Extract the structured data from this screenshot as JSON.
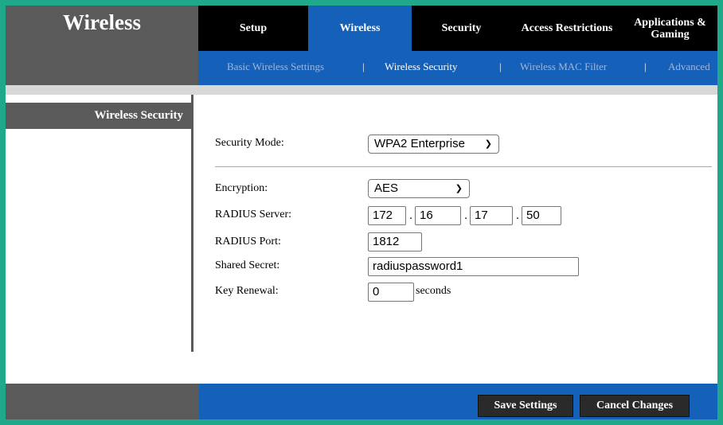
{
  "brand": {
    "title": "Wireless"
  },
  "tabs": [
    {
      "label": "Setup",
      "active": false
    },
    {
      "label": "Wireless",
      "active": true
    },
    {
      "label": "Security",
      "active": false
    },
    {
      "label": "Access Restrictions",
      "active": false
    },
    {
      "label": "Applications & Gaming",
      "active": false
    }
  ],
  "subnav": {
    "items": [
      "Basic Wireless Settings",
      "Wireless Security",
      "Wireless MAC Filter",
      "Advanced"
    ],
    "active": "Wireless Security",
    "separator": "|"
  },
  "sidebar": {
    "heading": "Wireless Security"
  },
  "form": {
    "security_mode_label": "Security Mode:",
    "security_mode_value": "WPA2 Enterprise",
    "encryption_label": "Encryption:",
    "encryption_value": "AES",
    "radius_server_label": "RADIUS Server:",
    "radius_server_octets": [
      "172",
      "16",
      "17",
      "50"
    ],
    "radius_server_dot": ".",
    "radius_port_label": "RADIUS Port:",
    "radius_port_value": "1812",
    "shared_secret_label": "Shared Secret:",
    "shared_secret_value": "radiuspassword1",
    "key_renewal_label": "Key Renewal:",
    "key_renewal_value": "0",
    "key_renewal_unit": "seconds"
  },
  "footer": {
    "save_label": "Save Settings",
    "cancel_label": "Cancel Changes"
  },
  "colors": {
    "frame": "#1fa98a",
    "blue": "#1560b8",
    "dark_gray": "#5a5a5a",
    "black": "#000000"
  }
}
